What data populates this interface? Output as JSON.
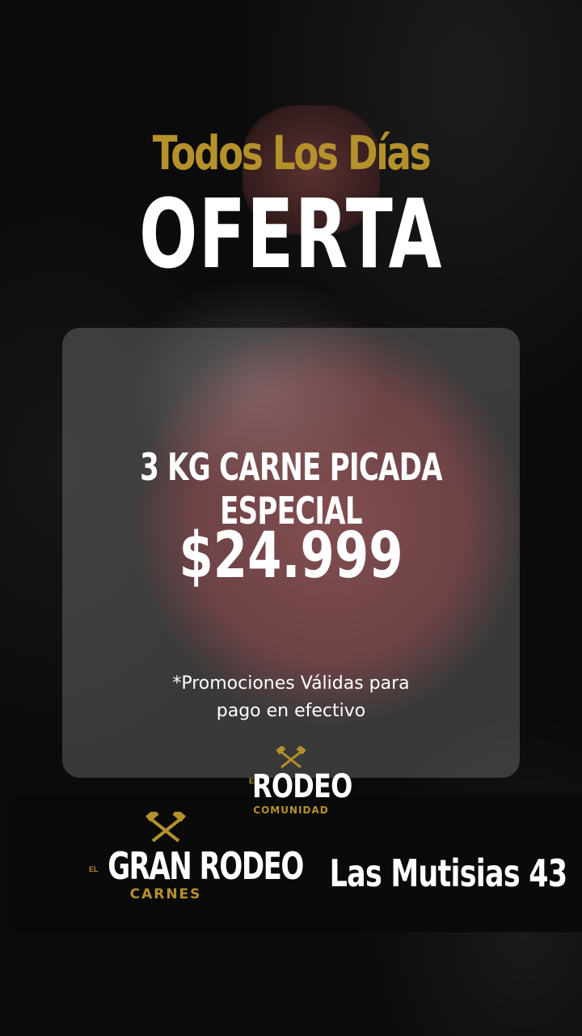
{
  "headline": "Todos Los Días",
  "title": "OFERTA",
  "offer": {
    "product": "3 KG CARNE PICADA ESPECIAL",
    "price": "$24.999",
    "promo_line1": "*Promociones Válidas para",
    "promo_line2": "pago en efectivo"
  },
  "logos": {
    "rodeo_prefix": "EL",
    "rodeo_name": "RODEO",
    "rodeo_sub": "COMUNIDAD",
    "gran_prefix": "EL",
    "gran_name": "GRAN RODEO",
    "gran_sub": "CARNES"
  },
  "address": "Las Mutisias 43",
  "colors": {
    "gold": "#b4912b",
    "white": "#ffffff",
    "background": "#0b0b0b"
  },
  "icons": [
    "crossed-knives-icon"
  ]
}
